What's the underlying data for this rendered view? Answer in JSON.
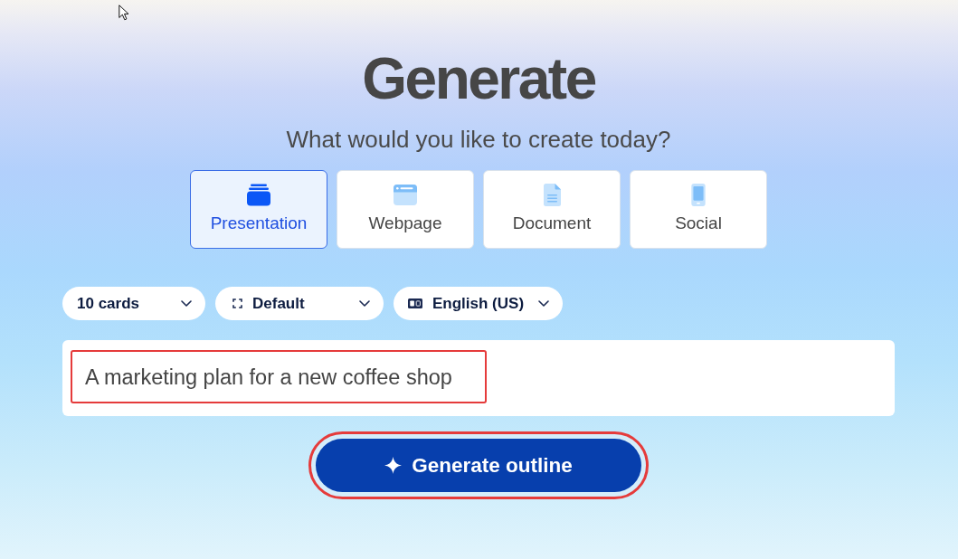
{
  "title": "Generate",
  "subtitle": "What would you like to create today?",
  "content_types": [
    {
      "kind": "presentation",
      "label": "Presentation",
      "selected": true
    },
    {
      "kind": "webpage",
      "label": "Webpage",
      "selected": false
    },
    {
      "kind": "document",
      "label": "Document",
      "selected": false
    },
    {
      "kind": "social",
      "label": "Social",
      "selected": false
    }
  ],
  "options": [
    {
      "kind": "count",
      "label": "10 cards"
    },
    {
      "kind": "layout",
      "label": "Default"
    },
    {
      "kind": "language",
      "label": "English (US)"
    }
  ],
  "prompt": {
    "value": "A marketing plan for a new coffee shop",
    "highlighted": true
  },
  "generate_button": {
    "label": "Generate outline",
    "highlighted": true
  }
}
